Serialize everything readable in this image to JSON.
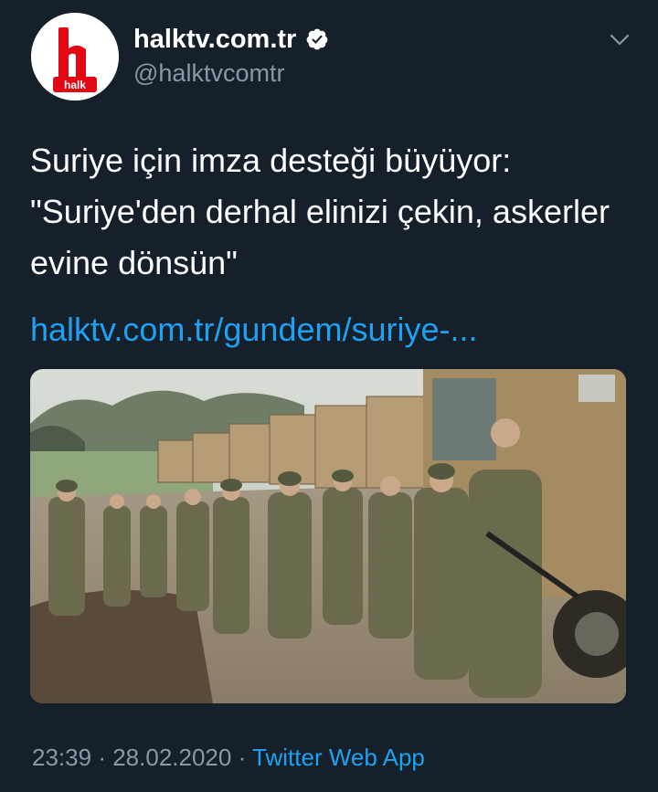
{
  "account": {
    "display_name": "halktv.com.tr",
    "handle": "@halktvcomtr",
    "verified": true,
    "avatar_label": "halk",
    "avatar_color": "#e30613"
  },
  "tweet": {
    "text_lines": [
      "Suriye için imza desteği büyüyor:",
      "\"Suriye'den derhal elinizi çekin, askerler",
      "evine dönsün\""
    ],
    "link": "halktv.com.tr/gundem/suriye-...",
    "media_description": "Soldiers walking along a dirt road beside a convoy of military trucks",
    "time": "23:39",
    "separator": "·",
    "date": "28.02.2020",
    "source_app": "Twitter Web App"
  },
  "colors": {
    "background": "#15202b",
    "text_primary": "#ffffff",
    "text_secondary": "#8899a6",
    "accent_link": "#1da1f2"
  },
  "icons": {
    "verified": "verified-badge-icon",
    "more": "chevron-down-icon"
  }
}
